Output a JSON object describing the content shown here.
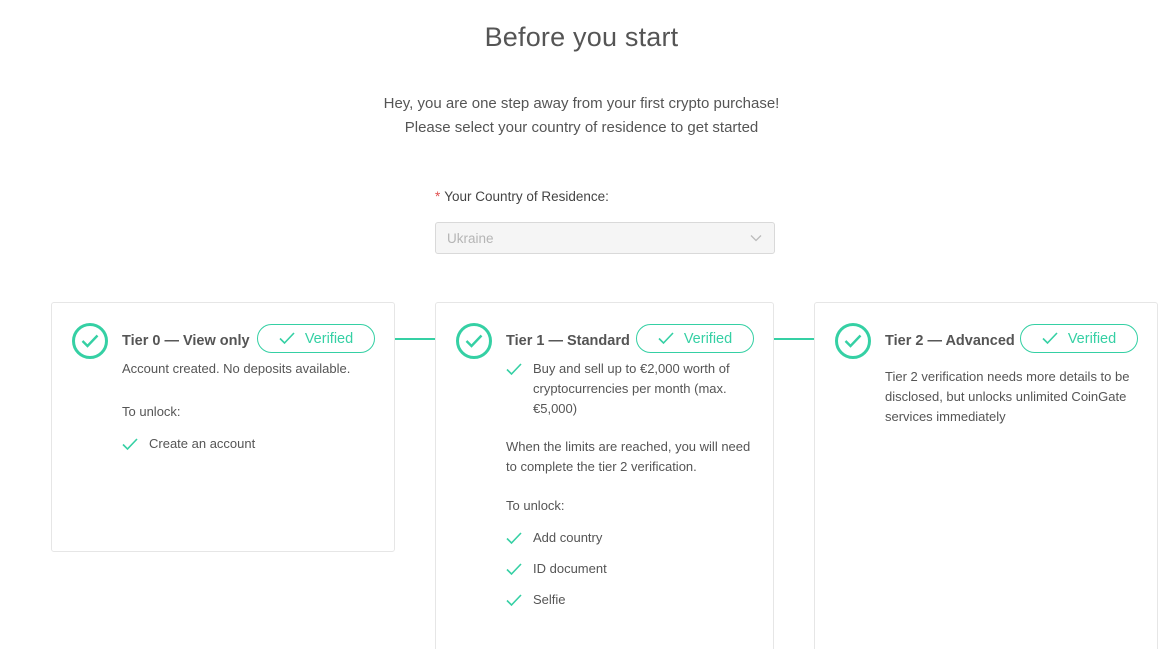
{
  "header": {
    "title": "Before you start",
    "line1": "Hey, you are one step away from your first crypto purchase!",
    "line2": "Please select your country of residence to get started"
  },
  "country_field": {
    "required_mark": "*",
    "label": "Your Country of Residence",
    "selected_value": "Ukraine"
  },
  "accent_color": "#35d0a4",
  "tiers": [
    {
      "name": "Tier 0 — View only",
      "badge": "Verified",
      "description": "Account created. No deposits available.",
      "unlock_label": "To unlock:",
      "unlock_items": [
        "Create an account"
      ]
    },
    {
      "name": "Tier 1 — Standard",
      "badge": "Verified",
      "benefit": "Buy and sell up to €2,000 worth of cryptocurrencies per month (max. €5,000)",
      "note": "When the limits are reached, you will need to complete the tier 2 verification.",
      "unlock_label": "To unlock:",
      "unlock_items": [
        "Add country",
        "ID document",
        "Selfie"
      ]
    },
    {
      "name": "Tier 2 — Advanced",
      "badge": "Verified",
      "description": "Tier 2 verification needs more details to be disclosed, but unlocks unlimited CoinGate services immediately"
    }
  ]
}
